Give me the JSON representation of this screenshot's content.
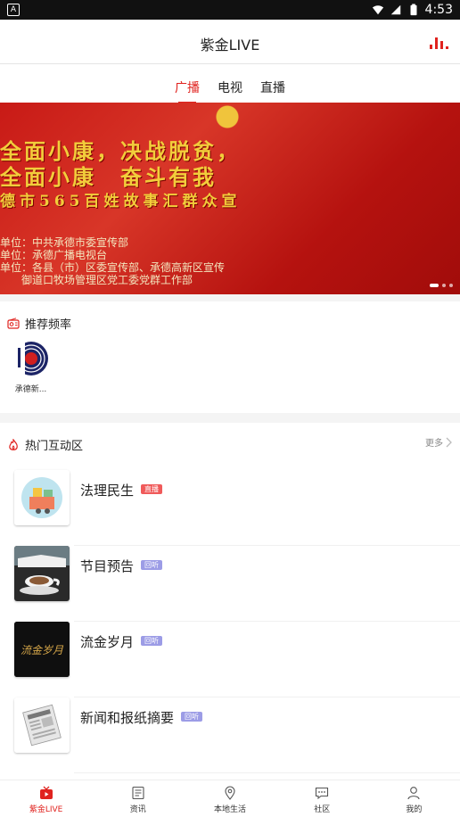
{
  "statusbar": {
    "notification_icon": "A",
    "time": "4:53"
  },
  "header": {
    "title": "紫金LIVE",
    "chart_icon": "bar-chart-icon"
  },
  "tabs": [
    {
      "label": "广播",
      "active": true
    },
    {
      "label": "电视",
      "active": false
    },
    {
      "label": "直播",
      "active": false
    }
  ],
  "banner": {
    "line1": "全面小康，决战脱贫，",
    "line2": "全面小康　奋斗有我",
    "line3": "德市565百姓故事汇群众宣",
    "info1": "单位：中共承德市委宣传部",
    "info2": "单位：承德广播电视台",
    "info3": "单位：各县（市）区委宣传部、承德高新区宣传",
    "info4": "　　御道口牧场管理区党工委党群工作部"
  },
  "recommended": {
    "title": "推荐频率",
    "channels": [
      {
        "label": "承德新..."
      }
    ]
  },
  "hot": {
    "title": "热门互动区",
    "more_label": "更多",
    "items": [
      {
        "title": "法理民生",
        "badge": "直播",
        "badge_color": "#f05a5a"
      },
      {
        "title": "节目预告",
        "badge": "回听",
        "badge_color": "#9c9ce6"
      },
      {
        "title": "流金岁月",
        "badge": "回听",
        "badge_color": "#9c9ce6"
      },
      {
        "title": "新闻和报纸摘要",
        "badge": "回听",
        "badge_color": "#9c9ce6"
      }
    ]
  },
  "thumbs": {
    "item3_text": "流金岁月"
  },
  "bottom_nav": [
    {
      "label": "紫金LIVE",
      "active": true
    },
    {
      "label": "资讯",
      "active": false
    },
    {
      "label": "本地生活",
      "active": false
    },
    {
      "label": "社区",
      "active": false
    },
    {
      "label": "我的",
      "active": false
    }
  ],
  "colors": {
    "accent": "#e0231f",
    "banner_text": "#f2cd3b"
  }
}
